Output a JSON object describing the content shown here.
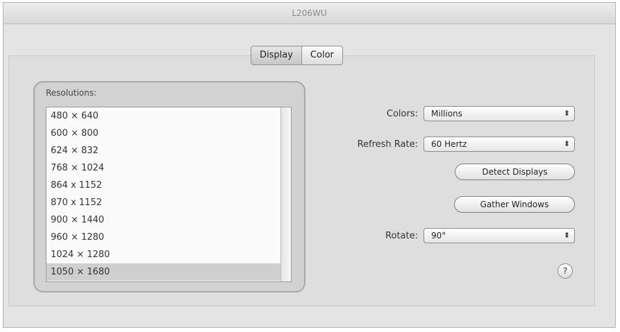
{
  "window": {
    "title": "L206WU"
  },
  "tabs": [
    {
      "label": "Display"
    },
    {
      "label": "Color"
    }
  ],
  "resolutions": {
    "label": "Resolutions:",
    "items": [
      "480 × 640",
      "600 × 800",
      "624 × 832",
      "768 × 1024",
      "864 x 1152",
      "870 x 1152",
      "900 × 1440",
      "960 × 1280",
      "1024 × 1280",
      "1050 × 1680"
    ],
    "selected_index": 9
  },
  "colors": {
    "label": "Colors:",
    "value": "Millions"
  },
  "refresh_rate": {
    "label": "Refresh Rate:",
    "value": "60 Hertz"
  },
  "buttons": {
    "detect": "Detect Displays",
    "gather": "Gather Windows"
  },
  "rotate": {
    "label": "Rotate:",
    "value": "90°"
  },
  "help": {
    "glyph": "?"
  },
  "icons": {
    "popup_arrows": "⬍"
  }
}
